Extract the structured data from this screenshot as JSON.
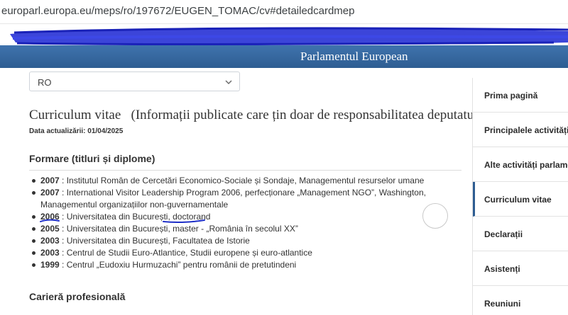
{
  "browser": {
    "url": "europarl.europa.eu/meps/ro/197672/EUGEN_TOMAC/cv#detailedcardmep"
  },
  "header": {
    "title": "Parlamentul European"
  },
  "language_select": {
    "value": "RO"
  },
  "page": {
    "title": "Curriculum vitae   (Informații publicate care țin doar de responsabilitatea deputatului)",
    "updated": "Data actualizării: 01/04/2025"
  },
  "education": {
    "title": "Formare (titluri și diplome)",
    "items": [
      {
        "year": "2007",
        "text": " : Institutul Român de Cercetări Economico-Sociale și Sondaje, Managementul resurselor umane"
      },
      {
        "year": "2007",
        "text": " : International Visitor Leadership Program 2006, perfecționare „Management NGO”, Washington, Managementul organizațiilor non-guvernamentale"
      },
      {
        "year": "2006",
        "text": " : Universitatea din București, doctorand"
      },
      {
        "year": "2005",
        "text": " : Universitatea din București, master - „România în secolul XX”"
      },
      {
        "year": "2003",
        "text": " : Universitatea din București, Facultatea de Istorie"
      },
      {
        "year": "2003",
        "text": " : Centrul de Studii Euro-Atlantice, Studii europene și euro-atlantice"
      },
      {
        "year": "1999",
        "text": " : Centrul „Eudoxiu Hurmuzachi” pentru românii de pretutindeni"
      }
    ]
  },
  "career": {
    "title": "Carieră profesională"
  },
  "sidenav": {
    "items": [
      {
        "label": "Prima pagină"
      },
      {
        "label": "Principalele activități p"
      },
      {
        "label": "Alte activități parlamen"
      },
      {
        "label": "Curriculum vitae"
      },
      {
        "label": "Declarații"
      },
      {
        "label": "Asistenți"
      },
      {
        "label": "Reuniuni"
      }
    ]
  },
  "colors": {
    "header_blue": "#2e5d92",
    "ink_blue": "#1e2fc8"
  },
  "icons": {
    "chevron": "chevron-down-icon"
  }
}
